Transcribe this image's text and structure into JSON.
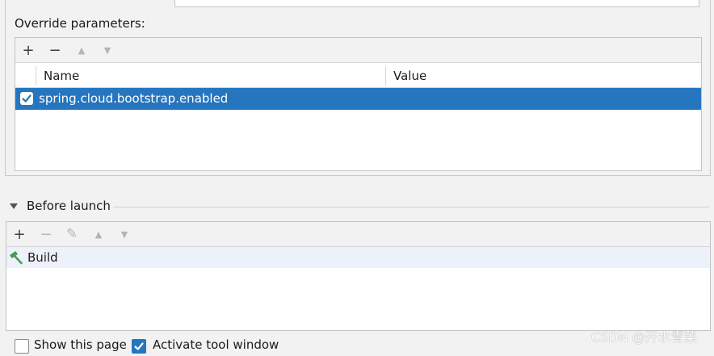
{
  "override": {
    "label": "Override parameters:",
    "toolbar": [
      {
        "icon": "add-icon",
        "glyph": "+",
        "enabled": true
      },
      {
        "icon": "remove-icon",
        "glyph": "−",
        "enabled": true
      },
      {
        "icon": "move-up-icon",
        "glyph": "▲",
        "enabled": false
      },
      {
        "icon": "move-down-icon",
        "glyph": "▼",
        "enabled": false
      }
    ],
    "columns": [
      "Name",
      "Value"
    ],
    "rows": [
      {
        "checked": true,
        "name": "spring.cloud.bootstrap.enabled",
        "value": ""
      }
    ]
  },
  "before_launch": {
    "title": "Before launch",
    "toolbar": [
      {
        "icon": "add-icon",
        "glyph": "+",
        "enabled": true
      },
      {
        "icon": "remove-icon",
        "glyph": "−",
        "enabled": false
      },
      {
        "icon": "edit-icon",
        "glyph": "✎",
        "enabled": false
      },
      {
        "icon": "move-up-icon",
        "glyph": "▲",
        "enabled": false
      },
      {
        "icon": "move-down-icon",
        "glyph": "▼",
        "enabled": false
      }
    ],
    "tasks": [
      {
        "icon": "hammer-icon",
        "label": "Build"
      }
    ]
  },
  "footer": {
    "show_page": {
      "label": "Show this page",
      "checked": false
    },
    "activate_tool": {
      "label": "Activate tool window",
      "checked": true
    }
  },
  "watermark": "CSDN @开水青菜",
  "colors": {
    "selection": "#2675bf",
    "accent_green": "#4a9a57"
  }
}
